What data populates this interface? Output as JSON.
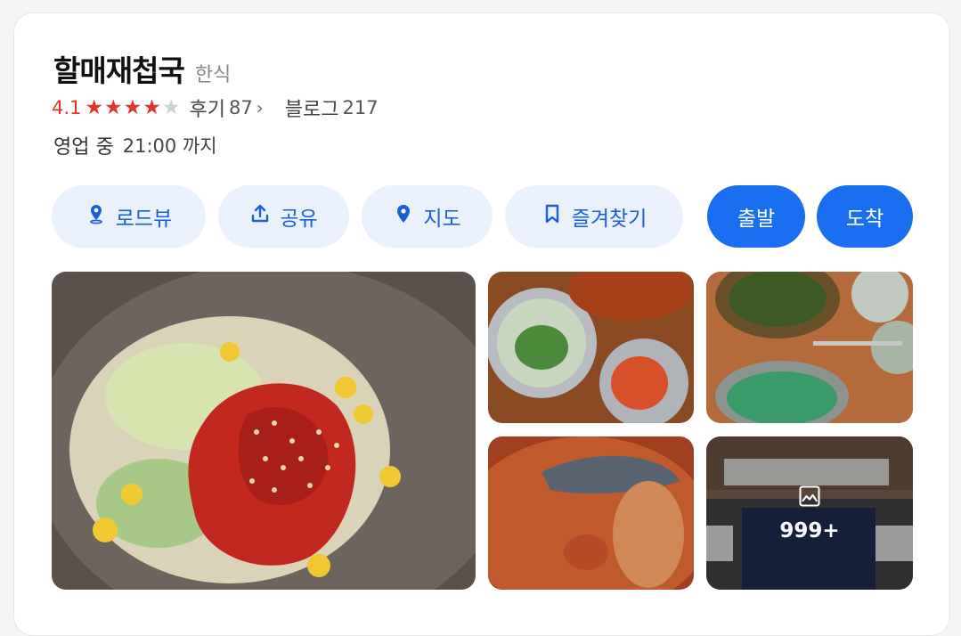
{
  "place": {
    "name": "할매재첩국",
    "category": "한식",
    "rating": "4.1",
    "stars_filled": 4,
    "stars_total": 5,
    "reviews_label": "후기",
    "reviews_count": "87",
    "blog_label": "블로그",
    "blog_count": "217",
    "status": "영업 중",
    "close_time": "21:00 까지"
  },
  "actions": {
    "roadview": "로드뷰",
    "share": "공유",
    "map": "지도",
    "favorite": "즐겨찾기",
    "depart": "출발",
    "arrive": "도착"
  },
  "photos": {
    "more_count": "999+"
  },
  "colors": {
    "accent": "#1a6ff0",
    "rating_red": "#e0362c",
    "light_button": "#eaf0fc"
  }
}
